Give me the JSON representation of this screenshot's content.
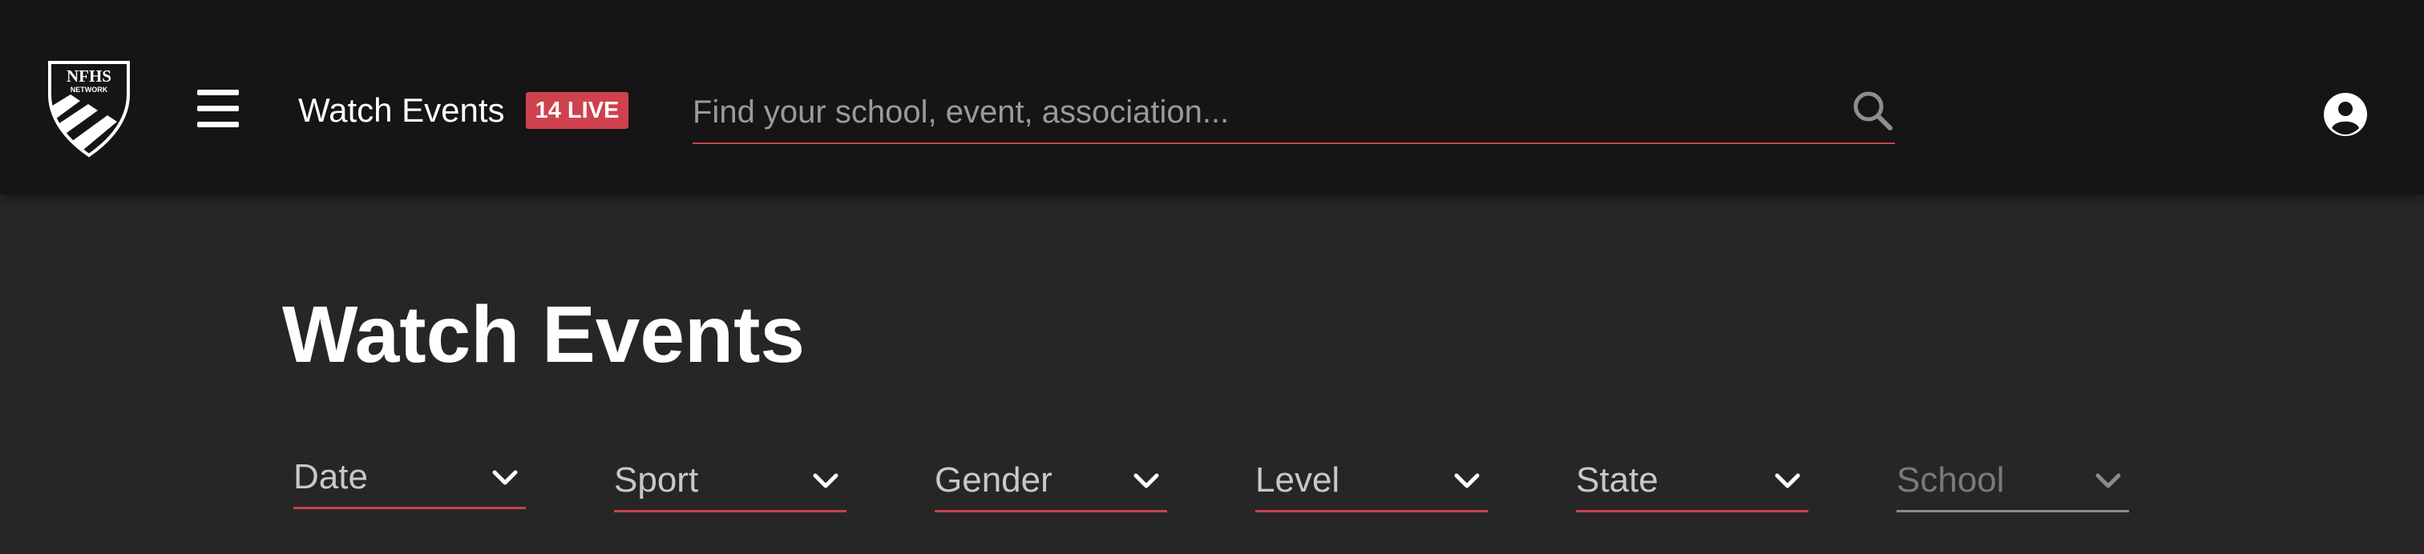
{
  "header": {
    "logo_lines": [
      "NFHS",
      "NETWORK"
    ],
    "watch_events_label": "Watch Events",
    "live_badge": "14 LIVE",
    "search": {
      "placeholder": "Find your school, event, association...",
      "value": ""
    }
  },
  "main": {
    "title": "Watch Events",
    "filters": [
      {
        "label": "Date",
        "enabled": true
      },
      {
        "label": "Sport",
        "enabled": true
      },
      {
        "label": "Gender",
        "enabled": true
      },
      {
        "label": "Level",
        "enabled": true
      },
      {
        "label": "State",
        "enabled": true
      },
      {
        "label": "School",
        "enabled": false
      }
    ]
  },
  "colors": {
    "header_bg": "#151515",
    "page_bg": "#262626",
    "accent": "#d0414e",
    "text": "#ffffff",
    "muted_text": "#c8c8c8",
    "disabled_text": "#7a7a7a"
  },
  "icons": {
    "logo": "nfhs-network-shield-icon",
    "menu": "hamburger-menu-icon",
    "search": "search-icon",
    "account": "account-circle-icon",
    "dropdown": "chevron-down-icon"
  }
}
